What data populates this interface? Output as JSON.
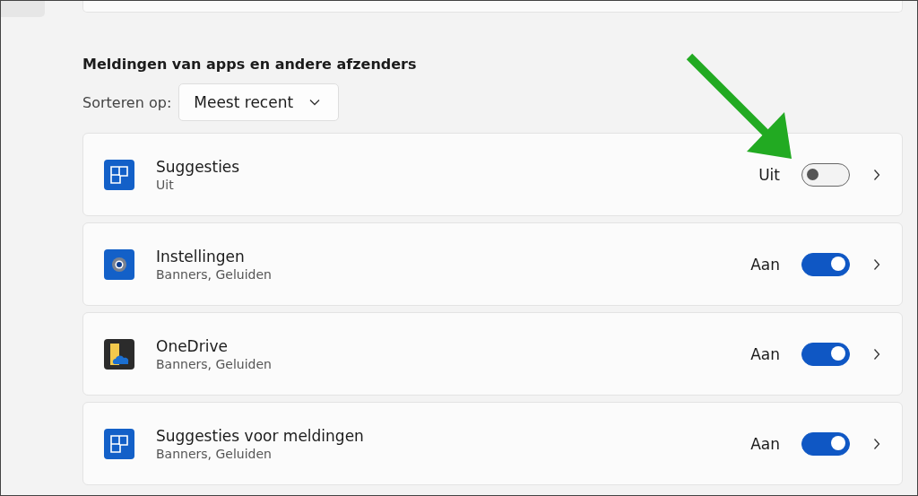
{
  "section": {
    "title": "Meldingen van apps en andere afzenders"
  },
  "sort": {
    "label": "Sorteren op:",
    "value": "Meest recent"
  },
  "apps": [
    {
      "kind": "tiles",
      "name": "Suggesties",
      "detail": "Uit",
      "state_label": "Uit",
      "on": false
    },
    {
      "kind": "gear",
      "name": "Instellingen",
      "detail": "Banners, Geluiden",
      "state_label": "Aan",
      "on": true
    },
    {
      "kind": "folder-cloud",
      "name": "OneDrive",
      "detail": "Banners, Geluiden",
      "state_label": "Aan",
      "on": true
    },
    {
      "kind": "tiles",
      "name": "Suggesties voor meldingen",
      "detail": "Banners, Geluiden",
      "state_label": "Aan",
      "on": true
    }
  ]
}
